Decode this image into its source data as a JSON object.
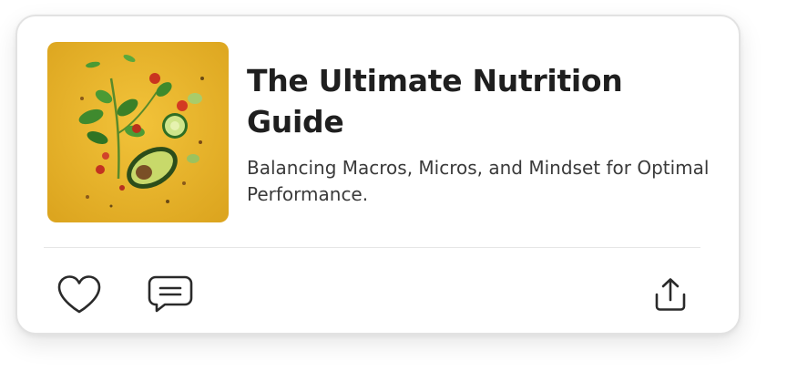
{
  "article": {
    "title": "The Ultimate Nutrition Guide",
    "subtitle": "Balancing Macros, Micros, and Mindset for Optimal Performance."
  },
  "thumbnail": {
    "background_color": "#e9b52b",
    "depicts": "vegetables and avocado image"
  },
  "actions": {
    "like_icon": "heart-icon",
    "comment_icon": "comment-icon",
    "share_icon": "share-icon"
  },
  "colors": {
    "title": "#1f1f1f",
    "text": "#3a3a3a",
    "icon": "#2a2a2a",
    "card_border": "#e2e2e2",
    "divider": "#e6e6e6"
  }
}
